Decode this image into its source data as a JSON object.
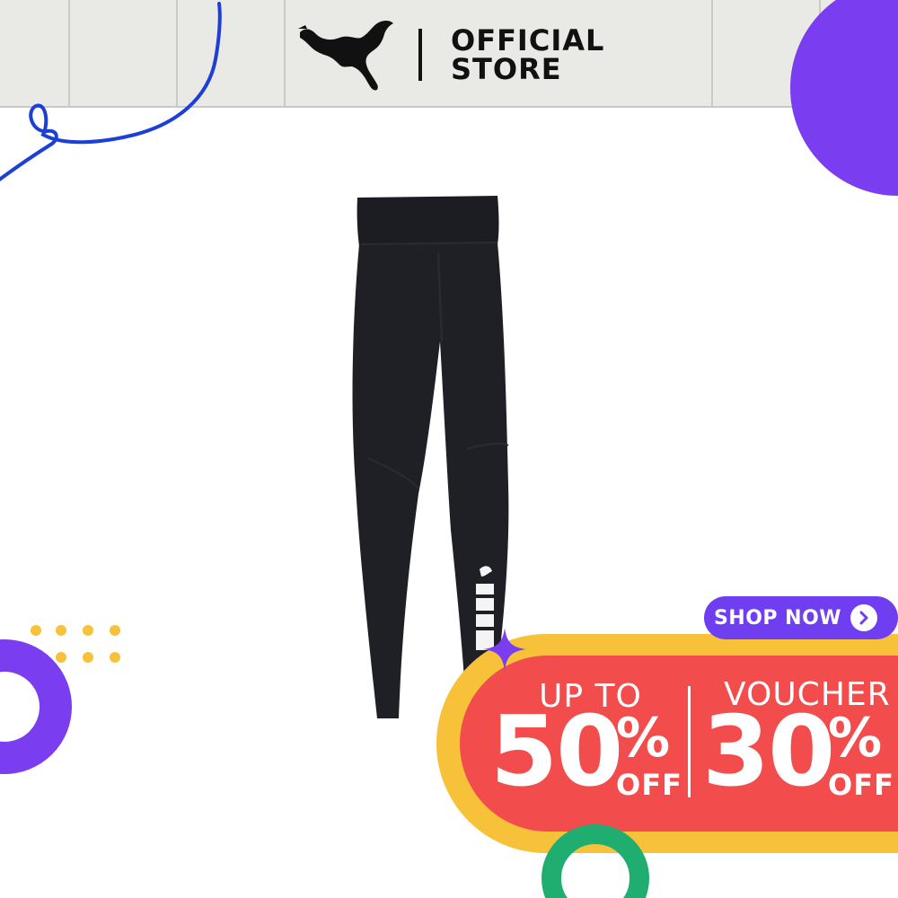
{
  "header": {
    "brand_logo": "puma-cat-icon",
    "store_line1": "OFFICIAL",
    "store_line2": "STORE"
  },
  "product": {
    "image": "black-leggings-image"
  },
  "promo": {
    "shop_now_label": "SHOP NOW",
    "left_label": "UP TO",
    "left_value": "50",
    "left_percent": "%",
    "left_off": "OFF",
    "right_label": "VOUCHER",
    "right_value": "30",
    "right_percent": "%",
    "right_off": "OFF"
  },
  "colors": {
    "header_bg": "#e9e9e5",
    "accent_purple": "#7a3df0",
    "shop_now_purple": "#6e3ef0",
    "promo_red": "#f24c4c",
    "promo_yellow": "#f7c23a",
    "ring_green": "#1fae70",
    "squiggle_blue": "#1c3fd6"
  }
}
